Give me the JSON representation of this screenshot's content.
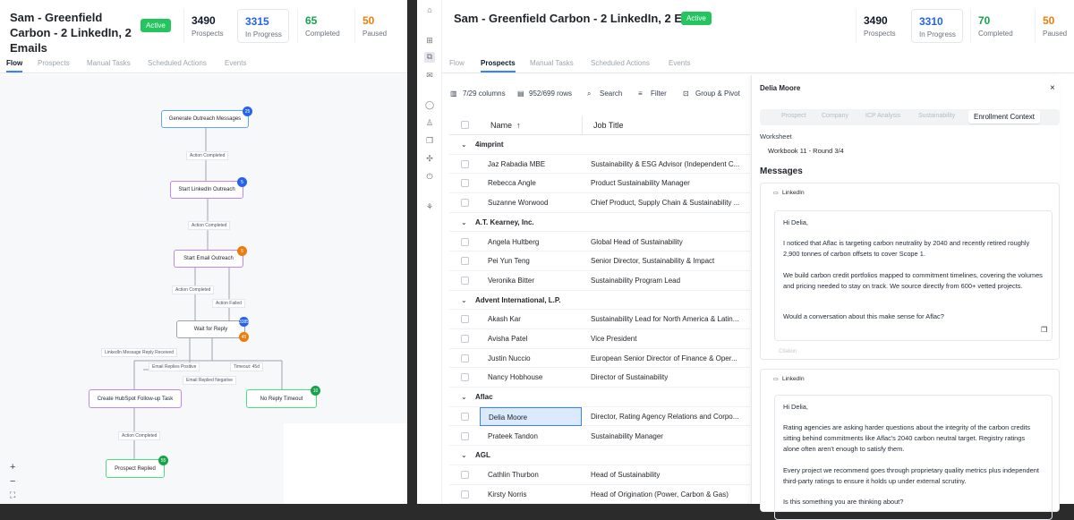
{
  "left_panel": {
    "title": "Sam - Greenfield Carbon - 2 LinkedIn, 2 Emails",
    "status_badge": "Active",
    "stats": [
      {
        "value": "3490",
        "label": "Prospects",
        "color": "#111827"
      },
      {
        "value": "3315",
        "label": "In Progress",
        "color": "#2563eb"
      },
      {
        "value": "65",
        "label": "Completed",
        "color": "#16a34a"
      },
      {
        "value": "50",
        "label": "Paused",
        "color": "#ea7d0c"
      }
    ],
    "tabs": [
      "Flow",
      "Prospects",
      "Manual Tasks",
      "Scheduled Actions",
      "Events"
    ],
    "active_tab": "Flow",
    "flow": {
      "nodes": [
        {
          "label": "Generate Outreach Messages",
          "count": "25"
        },
        {
          "label": "Start LinkedIn Outreach",
          "count": "5"
        },
        {
          "label": "Start Email Outreach",
          "count": "5"
        },
        {
          "label": "Wait for Reply",
          "count": "3385",
          "count2": "45"
        },
        {
          "label": "Create HubSpot Follow-up Task",
          "count": ""
        },
        {
          "label": "No Reply Timeout",
          "count": "10"
        },
        {
          "label": "Prospect Replied",
          "count": "55"
        }
      ],
      "edge_labels": [
        "Action Completed",
        "Action Completed",
        "Action Completed",
        "Action Failed",
        "LinkedIn Message Reply Received",
        "Email Replies Positive",
        "Timeout: 45d",
        "Email Replied Negative",
        "Action Completed"
      ]
    },
    "zoom_controls": [
      "+",
      "−",
      "⛶"
    ]
  },
  "right_panel": {
    "title": "Sam - Greenfield Carbon - 2 LinkedIn, 2 Emails",
    "status_badge": "Active",
    "stats": [
      {
        "value": "3490",
        "label": "Prospects",
        "color": "#111827"
      },
      {
        "value": "3310",
        "label": "In Progress",
        "color": "#2563eb"
      },
      {
        "value": "70",
        "label": "Completed",
        "color": "#16a34a"
      },
      {
        "value": "50",
        "label": "Paused",
        "color": "#ea7d0c"
      }
    ],
    "tabs": [
      "Flow",
      "Prospects",
      "Manual Tasks",
      "Scheduled Actions",
      "Events"
    ],
    "active_tab": "Prospects",
    "toolbar": {
      "columns": "7/29 columns",
      "rows": "952/699 rows",
      "search": "Search",
      "filter": "Filter",
      "group": "Group & Pivot"
    },
    "table": {
      "headers": [
        "Name",
        "Job Title"
      ],
      "rows": [
        {
          "group": "4imprint"
        },
        {
          "name": "Jaz Rabadia MBE",
          "title": "Sustainability & ESG Advisor (Independent C..."
        },
        {
          "name": "Rebecca Angle",
          "title": "Product Sustainability Manager"
        },
        {
          "name": "Suzanne Worwood",
          "title": "Chief Product, Supply Chain & Sustainability ..."
        },
        {
          "group": "A.T. Kearney, Inc."
        },
        {
          "name": "Angela Hultberg",
          "title": "Global Head of Sustainability"
        },
        {
          "name": "Pei Yun Teng",
          "title": "Senior Director, Sustainability & Impact"
        },
        {
          "name": "Veronika Bitter",
          "title": "Sustainability Program Lead"
        },
        {
          "group": "Advent International, L.P."
        },
        {
          "name": "Akash Kar",
          "title": "Sustainability Lead for North America & Latin..."
        },
        {
          "name": "Avisha Patel",
          "title": "Vice President"
        },
        {
          "name": "Justin Nuccio",
          "title": "European Senior Director of Finance & Oper..."
        },
        {
          "name": "Nancy Hobhouse",
          "title": "Director of Sustainability"
        },
        {
          "group": "Aflac"
        },
        {
          "name": "Delia Moore",
          "title": "Director, Rating Agency Relations and Corpo...",
          "selected": true
        },
        {
          "name": "Prateek Tandon",
          "title": "Sustainability Manager"
        },
        {
          "group": "AGL"
        },
        {
          "name": "Cathlin Thurbon",
          "title": "Head of Sustainability"
        },
        {
          "name": "Kirsty Norris",
          "title": "Head of Origination (Power, Carbon & Gas)"
        }
      ]
    },
    "drawer": {
      "name": "Delia Moore",
      "tabs": [
        "Prospect",
        "Company",
        "ICP Analysis",
        "Sustainability",
        "Enrollment Context"
      ],
      "active_tab": "Enrollment Context",
      "worksheet_label": "Worksheet",
      "worksheet_value": "Workbook 11 - Round 3/4",
      "messages_heading": "Messages",
      "messages": [
        {
          "channel": "LinkedIn",
          "paragraphs": [
            "Hi Delia,",
            "I noticed that Aflac is targeting carbon neutrality by 2040 and recently retired roughly 2,900 tonnes of carbon offsets to cover Scope 1.",
            "We build carbon credit portfolios mapped to commitment timelines, covering the volumes and pricing needed to stay on track. We source directly from 600+ vetted projects.",
            "Would a conversation about this make sense for Aflac?"
          ],
          "footer": "Citation"
        },
        {
          "channel": "LinkedIn",
          "paragraphs": [
            "Hi Delia,",
            "Rating agencies are asking harder questions about the integrity of the carbon credits sitting behind commitments like Aflac's 2040 carbon neutral target. Registry ratings alone often aren't enough to satisfy them.",
            "Every project we recommend goes through proprietary quality metrics plus independent third-party ratings to ensure it holds up under external scrutiny.",
            "Is this something you are thinking about?"
          ]
        }
      ]
    }
  }
}
